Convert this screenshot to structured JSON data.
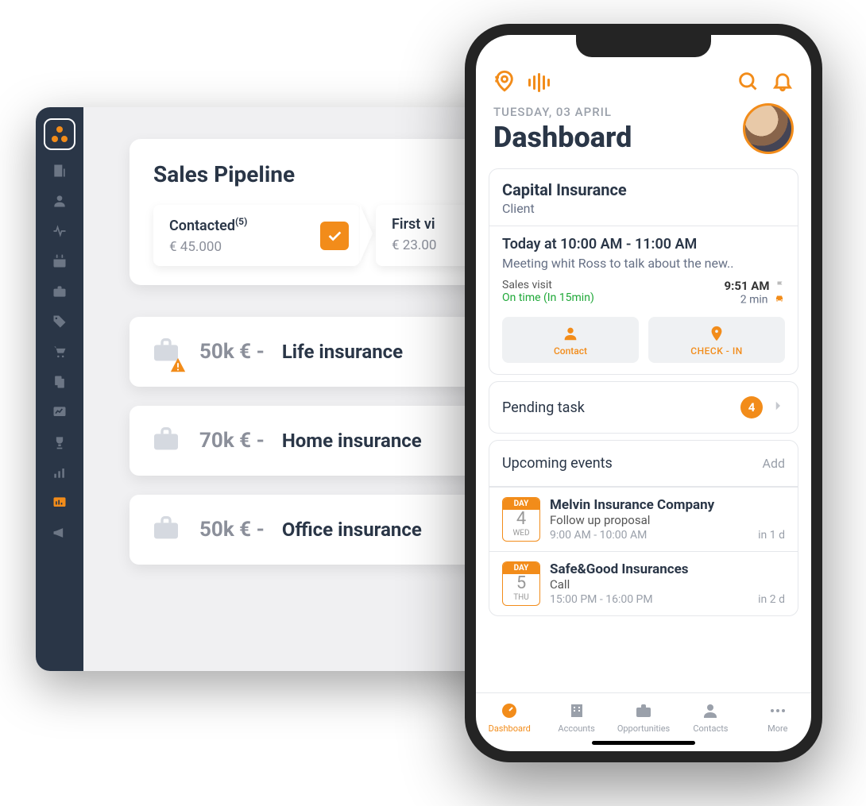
{
  "desktop": {
    "pipeline": {
      "title": "Sales Pipeline",
      "stages": [
        {
          "name": "Contacted",
          "count": "(5)",
          "amount": "€ 45.000"
        },
        {
          "name": "First vi",
          "amount": "€ 23.00"
        }
      ]
    },
    "deals": [
      {
        "amount": "50k € -",
        "name": "Life insurance",
        "warn": true
      },
      {
        "amount": "70k € -",
        "name": "Home insurance",
        "warn": false
      },
      {
        "amount": "50k € -",
        "name": "Office insurance",
        "warn": false
      }
    ]
  },
  "mobile": {
    "date": "TUESDAY, 03 APRIL",
    "title": "Dashboard",
    "meeting": {
      "company": "Capital Insurance",
      "relation": "Client",
      "time": "Today at 10:00 AM - 11:00 AM",
      "desc": "Meeting whit Ross to talk about the new..",
      "visitLabel": "Sales visit",
      "arrival": "9:51 AM",
      "onTime": "On time (In 15min)",
      "distance": "2 min",
      "contactBtn": "Contact",
      "checkinBtn": "CHECK - IN"
    },
    "pending": {
      "label": "Pending task",
      "count": "4"
    },
    "upcoming": {
      "label": "Upcoming events",
      "add": "Add"
    },
    "events": [
      {
        "dayLabel": "DAY",
        "dayNum": "4",
        "dow": "WED",
        "title": "Melvin Insurance Company",
        "sub": "Follow up proposal",
        "time": "9:00 AM - 10:00 AM",
        "eta": "in 1 d"
      },
      {
        "dayLabel": "DAY",
        "dayNum": "5",
        "dow": "THU",
        "title": "Safe&Good Insurances",
        "sub": "Call",
        "time": "15:00 PM - 16:00 PM",
        "eta": "in 2 d"
      }
    ],
    "tabs": [
      {
        "label": "Dashboard"
      },
      {
        "label": "Accounts"
      },
      {
        "label": "Opportunities"
      },
      {
        "label": "Contacts"
      },
      {
        "label": "More"
      }
    ]
  }
}
